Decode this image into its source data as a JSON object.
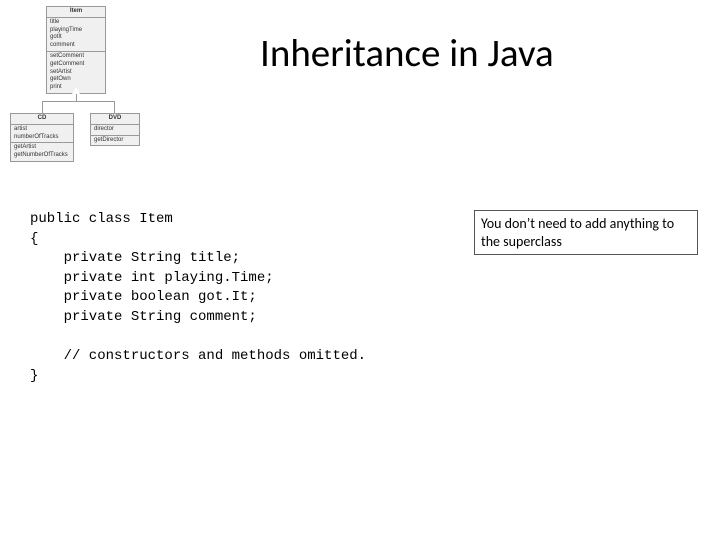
{
  "title": "Inheritance in Java",
  "uml": {
    "item": {
      "name": "Item",
      "attrs": [
        "title",
        "playingTime",
        "gotIt",
        "comment"
      ],
      "ops": [
        "setComment",
        "getComment",
        "setArtist",
        "getOwn",
        "print"
      ]
    },
    "cd": {
      "name": "CD",
      "attrs": [
        "artist",
        "numberOfTracks"
      ],
      "ops": [
        "getArtist",
        "getNumberOfTracks"
      ]
    },
    "dvd": {
      "name": "DVD",
      "attrs": [
        "director"
      ],
      "ops": [
        "getDirector"
      ]
    }
  },
  "code": {
    "l0": "public class Item",
    "l1": "{",
    "l2": "    private String title;",
    "l3": "    private int playing.Time;",
    "l4": "    private boolean got.It;",
    "l5": "    private String comment;",
    "l6": "",
    "l7": "    // constructors and methods omitted.",
    "l8": "}"
  },
  "note": "You don’t need to add anything to the superclass"
}
